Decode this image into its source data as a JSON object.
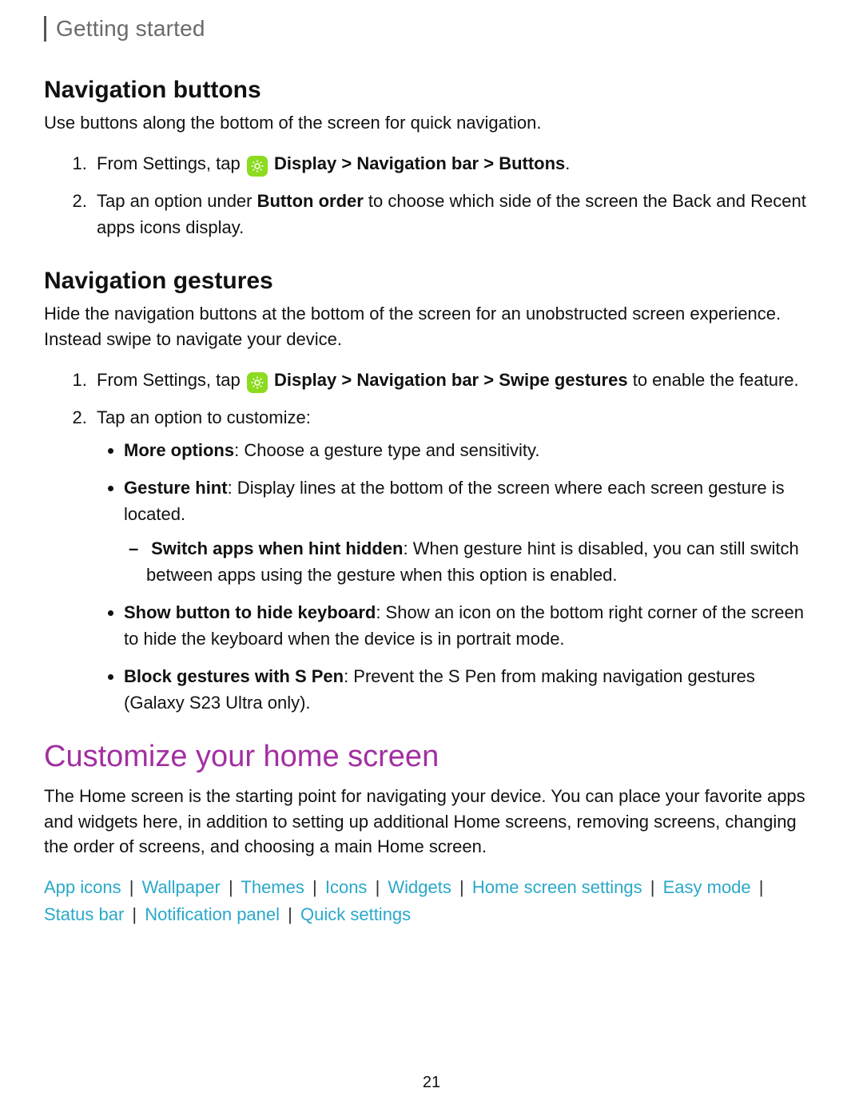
{
  "breadcrumb": "Getting started",
  "nav_buttons": {
    "heading": "Navigation buttons",
    "intro": "Use buttons along the bottom of the screen for quick navigation.",
    "step1_prefix": "From Settings, tap ",
    "step1_bold": "Display > Navigation bar > Buttons",
    "step1_suffix": ".",
    "step2_a": "Tap an option under ",
    "step2_bold": "Button order",
    "step2_b": " to choose which side of the screen the Back and Recent apps icons display."
  },
  "nav_gestures": {
    "heading": "Navigation gestures",
    "intro": "Hide the navigation buttons at the bottom of the screen for an unobstructed screen experience. Instead swipe to navigate your device.",
    "step1_prefix": "From Settings, tap ",
    "step1_bold": "Display > Navigation bar > Swipe gestures",
    "step1_suffix": " to enable the feature.",
    "step2": "Tap an option to customize:",
    "opts": {
      "more_label": "More options",
      "more_text": ": Choose a gesture type and sensitivity.",
      "hint_label": "Gesture hint",
      "hint_text": ": Display lines at the bottom of the screen where each screen gesture is located.",
      "switch_label": "Switch apps when hint hidden",
      "switch_text": ": When gesture hint is disabled, you can still switch between apps using the gesture when this option is enabled.",
      "hidekb_label": "Show button to hide keyboard",
      "hidekb_text": ": Show an icon on the bottom right corner of the screen to hide the keyboard when the device is in portrait mode.",
      "spen_label": "Block gestures with S Pen",
      "spen_text": ": Prevent the S Pen from making navigation gestures (Galaxy S23 Ultra only)."
    }
  },
  "customize": {
    "heading": "Customize your home screen",
    "intro": "The Home screen is the starting point for navigating your device. You can place your favorite apps and widgets here, in addition to setting up additional Home screens, removing screens, changing the order of screens, and choosing a main Home screen.",
    "links": [
      "App icons",
      "Wallpaper",
      "Themes",
      "Icons",
      "Widgets",
      "Home screen settings",
      "Easy mode",
      "Status bar",
      "Notification panel",
      "Quick settings"
    ]
  },
  "page_number": "21",
  "icon_name": "display-icon"
}
